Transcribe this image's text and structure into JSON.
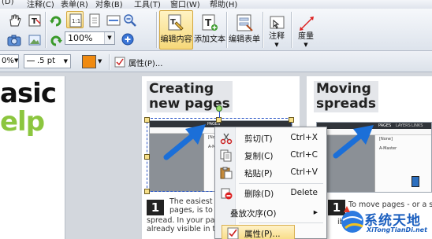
{
  "menubar": {
    "items": [
      "(D)",
      "注释(C)",
      "表单(R)",
      "对象(B)",
      "工具(T)",
      "窗口(W)",
      "帮助(H)"
    ]
  },
  "toolbar": {
    "zoom_value": "100%",
    "edit_content_label": "编辑内容",
    "add_text_label": "添加文本",
    "edit_form_label": "编辑表单",
    "annotate_label": "注释",
    "measure_label": "度量"
  },
  "formatbar": {
    "percent_value": "0%",
    "stroke_value": ".5 pt",
    "properties_label": "属性(P)..."
  },
  "document": {
    "left_word1": "asic",
    "left_word2": "elp",
    "heading_left_line1": "Creating",
    "heading_left_line2": "new pages",
    "heading_right_line1": "Moving",
    "heading_right_line2": "spreads",
    "step_number_left": "1",
    "step_number_right": "1",
    "body_left": [
      "The easiest w",
      "pages, is to d",
      "spread. In your page",
      "already visible in the"
    ],
    "body_right": [
      "To move pages - or a spre",
      "ible"
    ],
    "mini_pages_label": "PAGES",
    "mini_layers_label": "LAYERS",
    "mini_links_label": "LINKS",
    "mini_none_label": "[None]",
    "mini_master_label": "A-Master"
  },
  "context_menu": {
    "items": [
      {
        "label": "剪切(T)",
        "shortcut": "Ctrl+X",
        "icon": "scissors-icon"
      },
      {
        "label": "复制(C)",
        "shortcut": "Ctrl+C",
        "icon": "copy-icon"
      },
      {
        "label": "粘贴(P)",
        "shortcut": "Ctrl+V",
        "icon": "paste-icon"
      },
      {
        "label": "删除(D)",
        "shortcut": "Delete",
        "icon": "delete-icon"
      },
      {
        "label": "叠放次序(O)",
        "shortcut": "▸",
        "icon": ""
      },
      {
        "label": "属性(P)...",
        "shortcut": "",
        "icon": "properties-icon"
      }
    ]
  },
  "watermark": {
    "title": "系统天地",
    "url": "XiTongTianDi.net"
  },
  "colors": {
    "accent_blue": "#1b6fd8",
    "highlight": "#f6d879",
    "green": "#8cc63f"
  }
}
